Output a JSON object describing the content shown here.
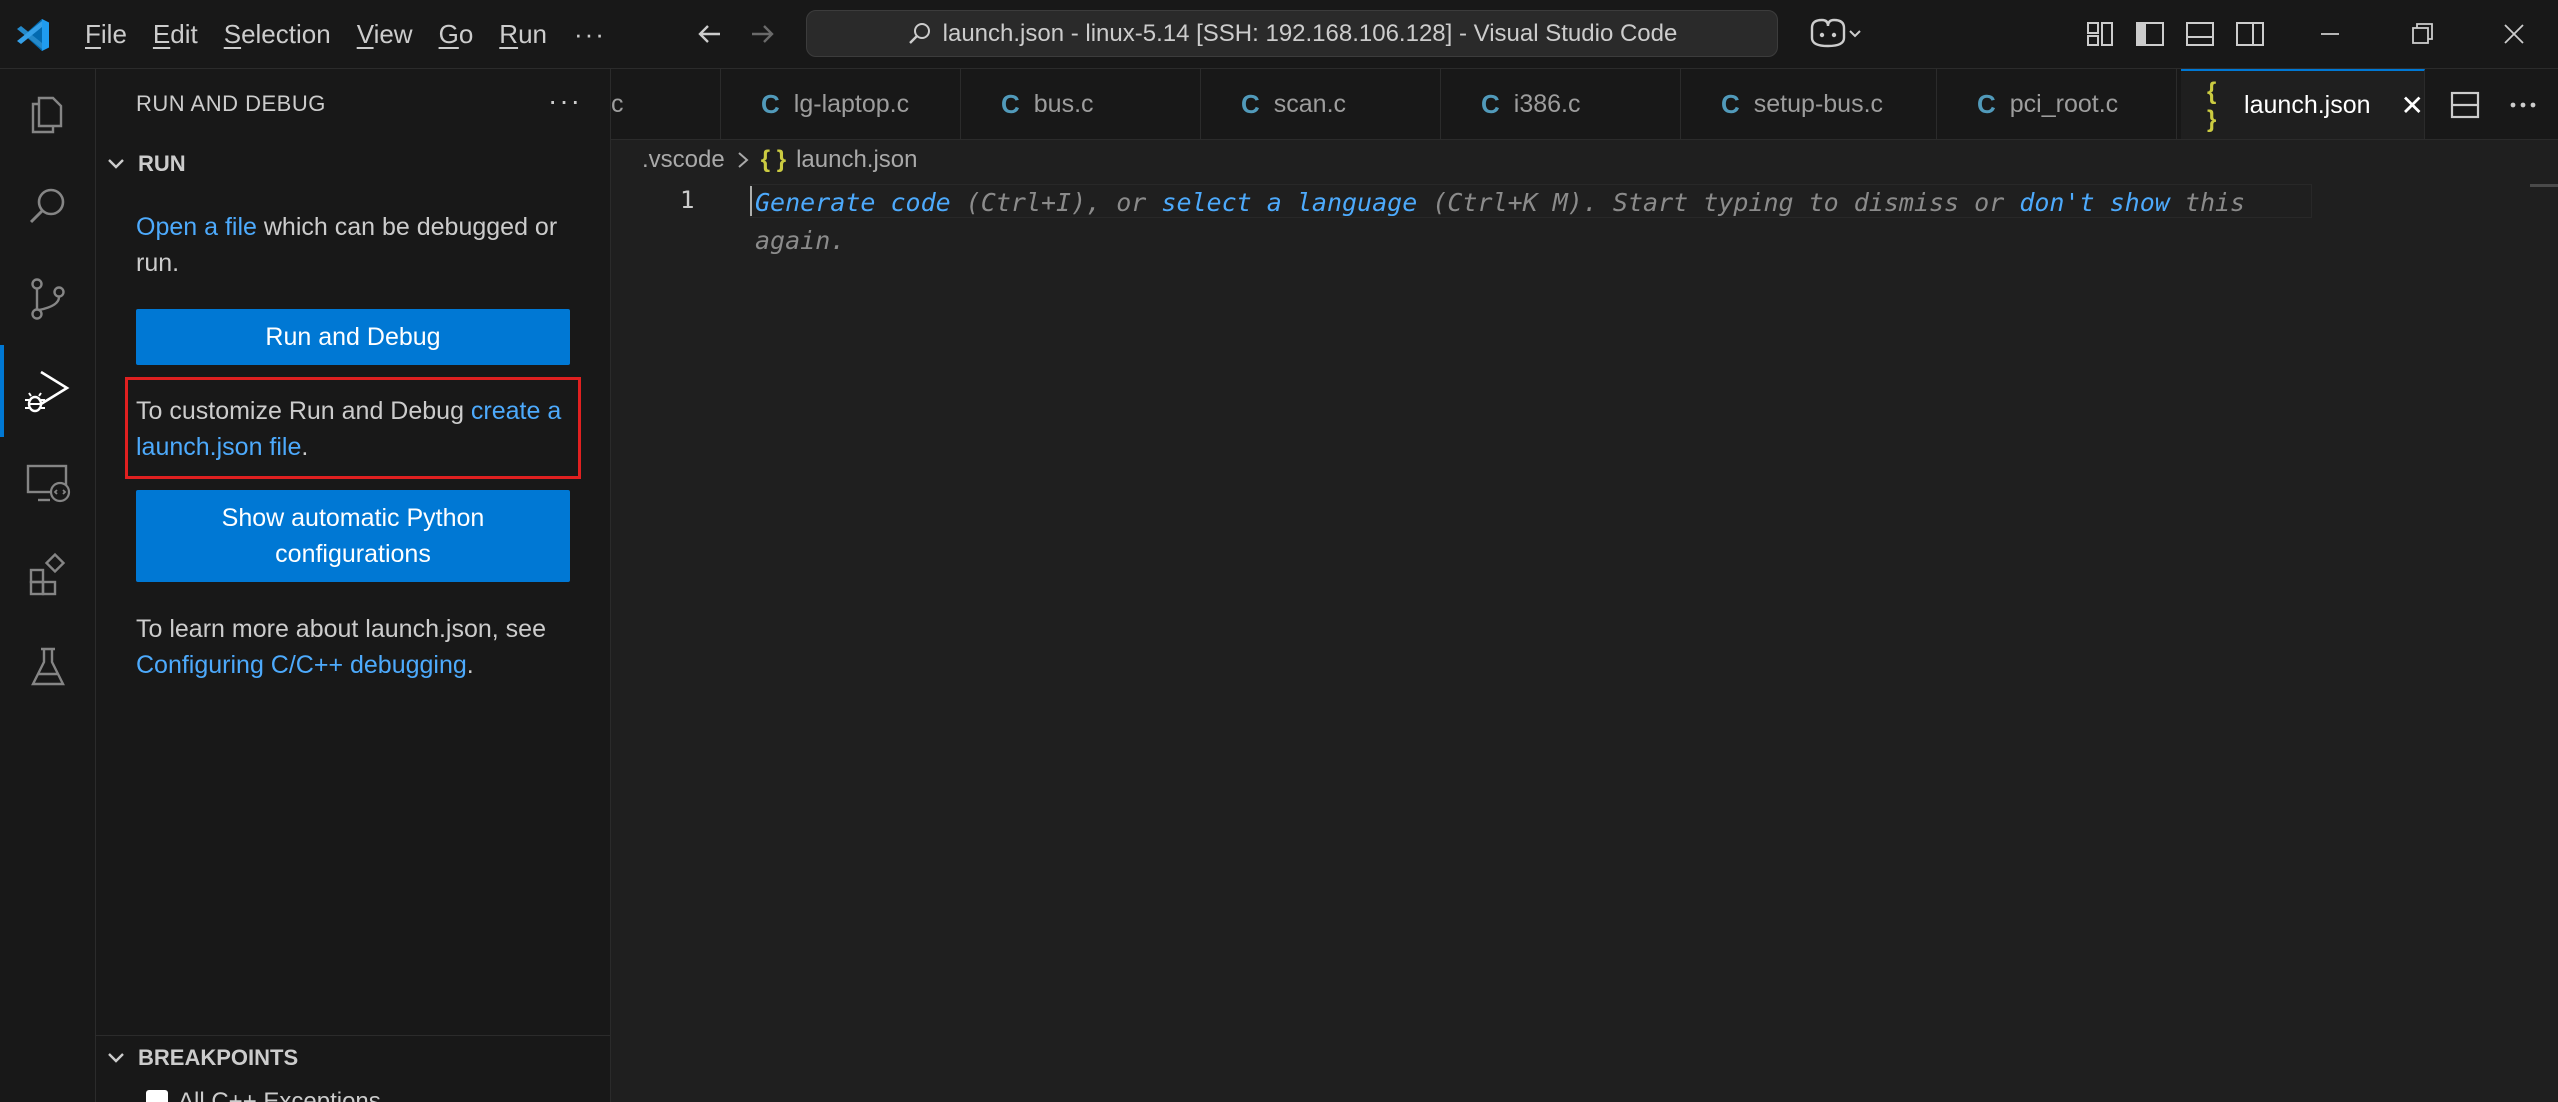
{
  "titlebar": {
    "menu": [
      {
        "label": "File",
        "accel": "F"
      },
      {
        "label": "Edit",
        "accel": "E"
      },
      {
        "label": "Selection",
        "accel": "S"
      },
      {
        "label": "View",
        "accel": "V"
      },
      {
        "label": "Go",
        "accel": "G"
      },
      {
        "label": "Run",
        "accel": "R"
      }
    ],
    "more": "···",
    "command_center": "launch.json - linux-5.14 [SSH: 192.168.106.128] - Visual Studio Code"
  },
  "sidebar": {
    "title": "RUN AND DEBUG",
    "more": "···",
    "run_section": "RUN",
    "open_file_link": "Open a file",
    "open_file_rest": " which can be debugged or run.",
    "run_debug_button": "Run and Debug",
    "customize_text": "To customize Run and Debug ",
    "customize_link": "create a launch.json file",
    "customize_end": ".",
    "python_button": "Show automatic Python configurations",
    "learn_text": "To learn more about launch.json, see ",
    "learn_link": "Configuring C/C++ debugging",
    "learn_end": ".",
    "breakpoints_section": "BREAKPOINTS",
    "breakpoint_item": "All C++ Exceptions"
  },
  "tabs": [
    {
      "label": "c",
      "icon": "c-file-icon"
    },
    {
      "label": "lg-laptop.c",
      "icon": "c-file-icon"
    },
    {
      "label": "bus.c",
      "icon": "c-file-icon"
    },
    {
      "label": "scan.c",
      "icon": "c-file-icon"
    },
    {
      "label": "i386.c",
      "icon": "c-file-icon"
    },
    {
      "label": "setup-bus.c",
      "icon": "c-file-icon"
    },
    {
      "label": "pci_root.c",
      "icon": "c-file-icon"
    },
    {
      "label": "launch.json",
      "icon": "json-file-icon",
      "active": true
    }
  ],
  "icons": {
    "c": "C",
    "json": "{ }",
    "close": "✕",
    "chevron": "›"
  },
  "breadcrumb": {
    "folder": ".vscode",
    "file": "launch.json"
  },
  "editor": {
    "line_number": "1",
    "hint": {
      "link1": "Generate code",
      "t1": " (Ctrl+I), or ",
      "link2": "select a language",
      "t2": " (Ctrl+K M). Start typing to dismiss or ",
      "link3": "don't show",
      "t3": " this again."
    }
  },
  "colors": {
    "accent": "#0078d4",
    "link": "#4daafc",
    "highlight": "#e02020"
  }
}
